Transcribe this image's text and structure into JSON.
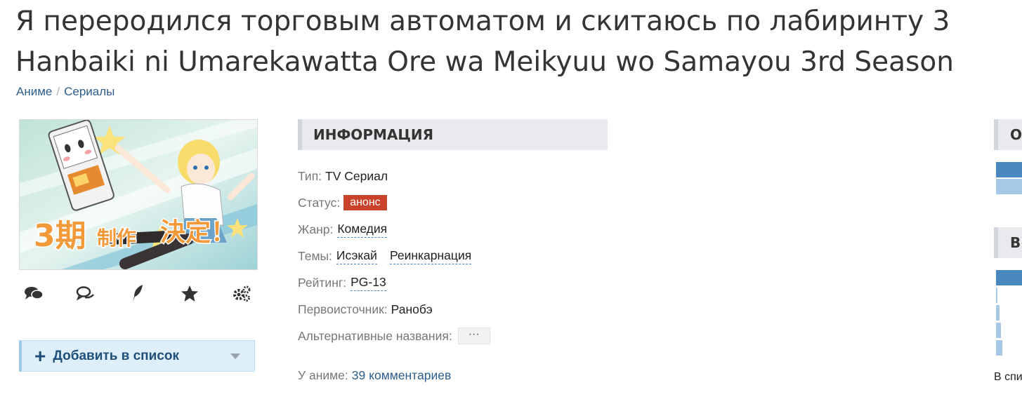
{
  "page": {
    "title_line1": "Я переродился торговым автоматом и скитаюсь по лабиринту 3",
    "title_line2": "Hanbaiki ni Umarekawatta Ore wa Meikyuu wo Samayou 3rd Season"
  },
  "breadcrumbs": [
    {
      "label": "Аниме"
    },
    {
      "label": "Сериалы"
    }
  ],
  "poster": {
    "alt": "3期 制作 決定！"
  },
  "actions": [
    {
      "icon": "comments-icon"
    },
    {
      "icon": "chat-bubbles-icon"
    },
    {
      "icon": "quill-icon"
    },
    {
      "icon": "star-icon"
    },
    {
      "icon": "gears-icon"
    }
  ],
  "add_to_list": {
    "label": "Добавить в список"
  },
  "info": {
    "heading": "ИНФОРМАЦИЯ",
    "type_label": "Тип:",
    "type_value": "TV Сериал",
    "status_label": "Статус:",
    "status_value": "анонс",
    "genre_label": "Жанр:",
    "genres": [
      "Комедия"
    ],
    "themes_label": "Темы:",
    "themes": [
      "Исэкай",
      "Реинкарнация"
    ],
    "rating_label": "Рейтинг:",
    "rating_value": "PG-13",
    "source_label": "Первоисточник:",
    "source_value": "Ранобэ",
    "alt_names_label": "Альтернативные названия:",
    "alt_names_button": "···"
  },
  "comments": {
    "label": "У аниме:",
    "link": "39 комментариев"
  },
  "sidebar": {
    "head1": "О",
    "head2": "В",
    "note": "В спи"
  },
  "colors": {
    "link": "#2d5d8a",
    "status_badge": "#c9432a",
    "add_button_bg": "#deeffa",
    "bar_dark": "#4a89c0",
    "bar_light": "#a7c8e6"
  }
}
